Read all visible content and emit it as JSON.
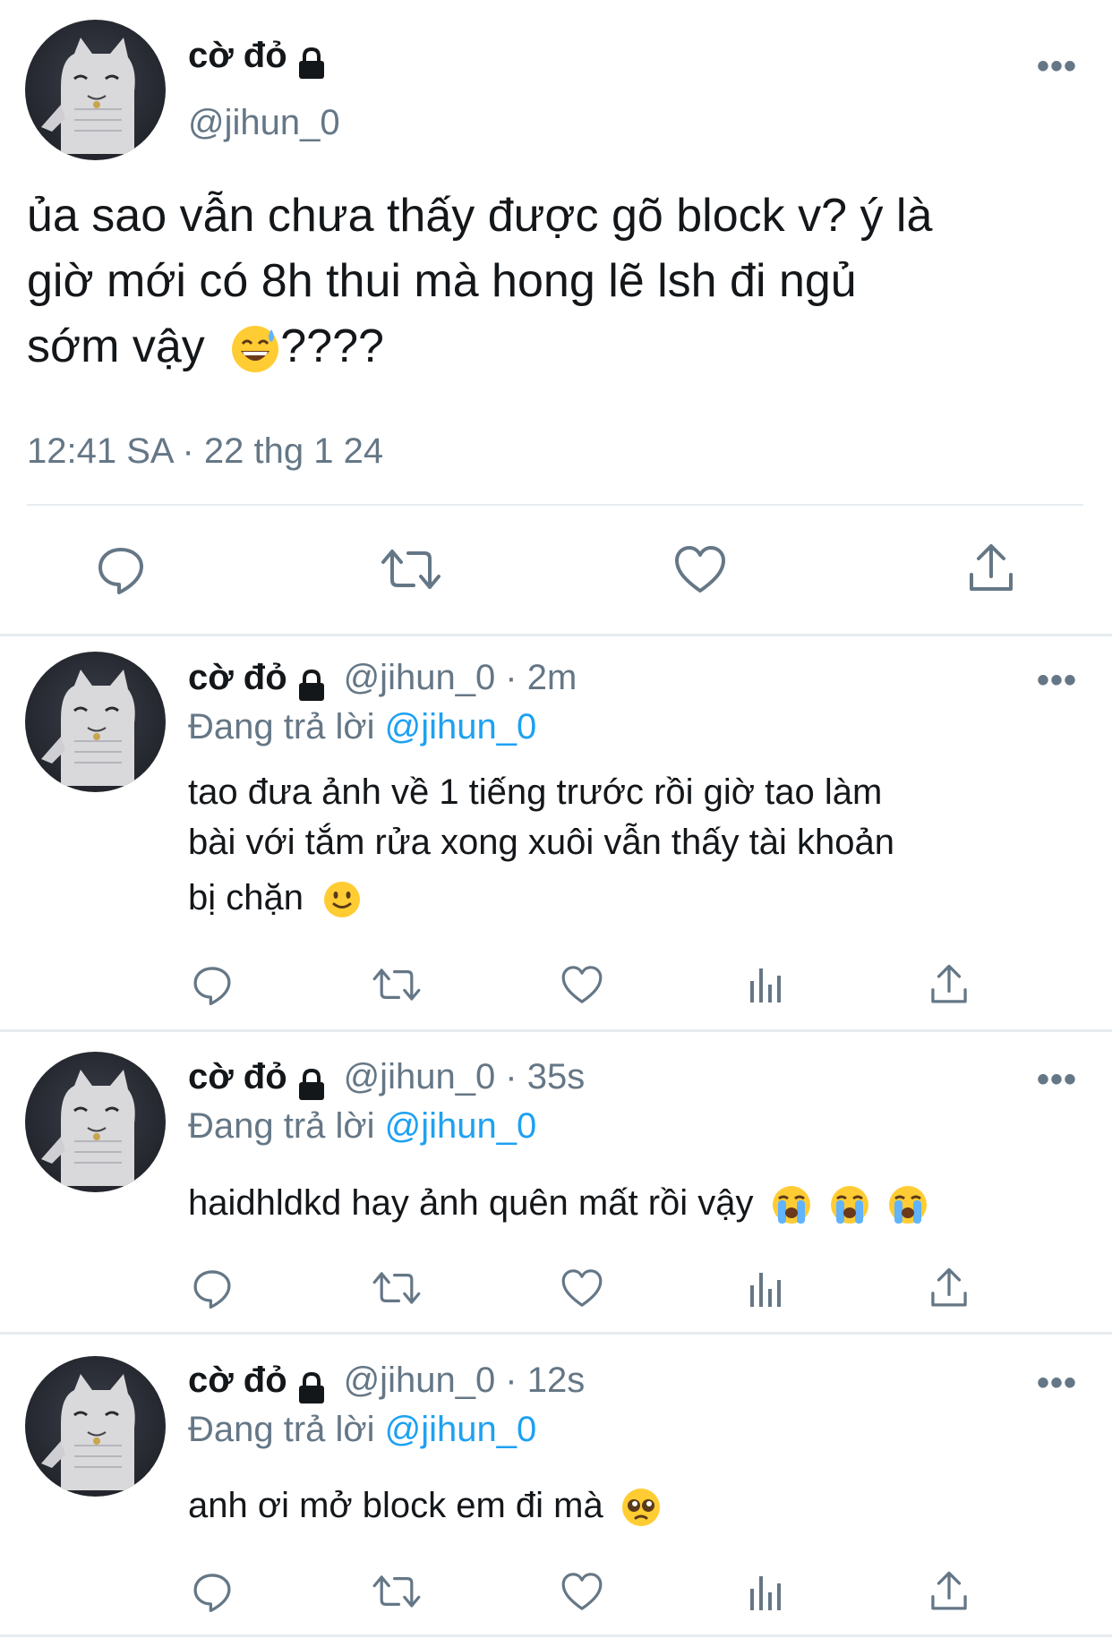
{
  "main_tweet": {
    "display_name": "cờ đỏ",
    "handle": "@jihun_0",
    "more_label": "•••",
    "text_lines": [
      "ủa sao vẫn chưa thấy được gõ block v? ý là",
      "giờ mới có 8h thui mà hong lẽ lsh đi ngủ",
      "sớm vậy",
      "????"
    ],
    "timestamp": "12:41 SA · 22 thg 1 24"
  },
  "replies": [
    {
      "display_name": "cờ đỏ",
      "handle_time": "@jihun_0 · 2m",
      "replying_prefix": "Đang trả lời",
      "replying_to": "@jihun_0",
      "text_lines": [
        "tao đưa ảnh về 1 tiếng trước rồi giờ tao làm",
        "bài với tắm rửa xong xuôi vẫn thấy tài khoản",
        "bị chặn"
      ]
    },
    {
      "display_name": "cờ đỏ",
      "handle_time": "@jihun_0 · 35s",
      "replying_prefix": "Đang trả lời",
      "replying_to": "@jihun_0",
      "text_lines": [
        "haidhldkd hay ảnh quên mất rồi vậy"
      ]
    },
    {
      "display_name": "cờ đỏ",
      "handle_time": "@jihun_0 · 12s",
      "replying_prefix": "Đang trả lời",
      "replying_to": "@jihun_0",
      "text_lines": [
        "anh ơi mở block em đi mà"
      ]
    }
  ],
  "more_label": "•••",
  "colors": {
    "accent": "#1da1f2",
    "secondary_text": "#657786",
    "divider": "#e6ecf0"
  }
}
